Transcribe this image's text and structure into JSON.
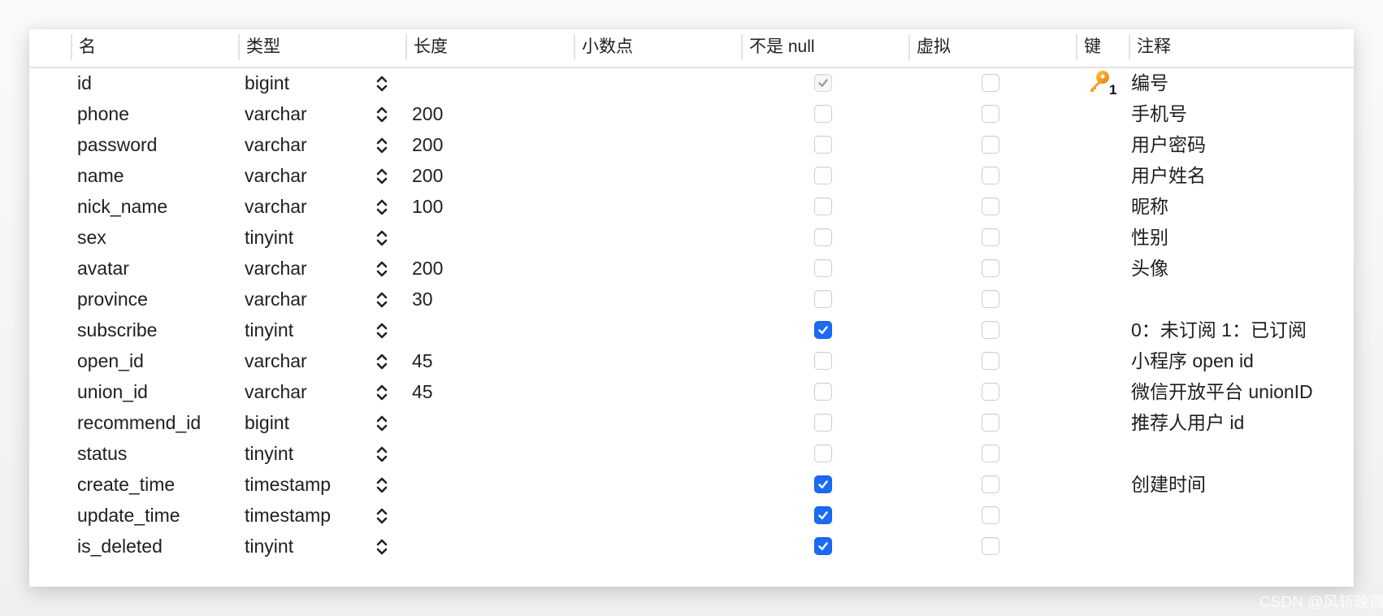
{
  "columns": [
    {
      "key": "name",
      "label": "名"
    },
    {
      "key": "type",
      "label": "类型"
    },
    {
      "key": "length",
      "label": "长度"
    },
    {
      "key": "decimals",
      "label": "小数点"
    },
    {
      "key": "not_null",
      "label": "不是 null"
    },
    {
      "key": "virtual",
      "label": "虚拟"
    },
    {
      "key": "key",
      "label": "键"
    },
    {
      "key": "comment",
      "label": "注释"
    }
  ],
  "rows": [
    {
      "name": "id",
      "type": "bigint",
      "length": "",
      "decimals": "",
      "not_null": true,
      "not_null_disabled": true,
      "virtual": false,
      "key": "primary",
      "key_index": "1",
      "comment": "编号"
    },
    {
      "name": "phone",
      "type": "varchar",
      "length": "200",
      "decimals": "",
      "not_null": false,
      "virtual": false,
      "key": "",
      "comment": "手机号"
    },
    {
      "name": "password",
      "type": "varchar",
      "length": "200",
      "decimals": "",
      "not_null": false,
      "virtual": false,
      "key": "",
      "comment": "用户密码"
    },
    {
      "name": "name",
      "type": "varchar",
      "length": "200",
      "decimals": "",
      "not_null": false,
      "virtual": false,
      "key": "",
      "comment": "用户姓名"
    },
    {
      "name": "nick_name",
      "type": "varchar",
      "length": "100",
      "decimals": "",
      "not_null": false,
      "virtual": false,
      "key": "",
      "comment": "昵称"
    },
    {
      "name": "sex",
      "type": "tinyint",
      "length": "",
      "decimals": "",
      "not_null": false,
      "virtual": false,
      "key": "",
      "comment": "性别"
    },
    {
      "name": "avatar",
      "type": "varchar",
      "length": "200",
      "decimals": "",
      "not_null": false,
      "virtual": false,
      "key": "",
      "comment": "头像"
    },
    {
      "name": "province",
      "type": "varchar",
      "length": "30",
      "decimals": "",
      "not_null": false,
      "virtual": false,
      "key": "",
      "comment": ""
    },
    {
      "name": "subscribe",
      "type": "tinyint",
      "length": "",
      "decimals": "",
      "not_null": true,
      "virtual": false,
      "key": "",
      "comment": "0：未订阅 1：已订阅"
    },
    {
      "name": "open_id",
      "type": "varchar",
      "length": "45",
      "decimals": "",
      "not_null": false,
      "virtual": false,
      "key": "",
      "comment": "小程序 open id"
    },
    {
      "name": "union_id",
      "type": "varchar",
      "length": "45",
      "decimals": "",
      "not_null": false,
      "virtual": false,
      "key": "",
      "comment": "微信开放平台 unionID"
    },
    {
      "name": "recommend_id",
      "type": "bigint",
      "length": "",
      "decimals": "",
      "not_null": false,
      "virtual": false,
      "key": "",
      "comment": "推荐人用户 id"
    },
    {
      "name": "status",
      "type": "tinyint",
      "length": "",
      "decimals": "",
      "not_null": false,
      "virtual": false,
      "key": "",
      "comment": ""
    },
    {
      "name": "create_time",
      "type": "timestamp",
      "length": "",
      "decimals": "",
      "not_null": true,
      "virtual": false,
      "key": "",
      "comment": "创建时间"
    },
    {
      "name": "update_time",
      "type": "timestamp",
      "length": "",
      "decimals": "",
      "not_null": true,
      "virtual": false,
      "key": "",
      "comment": ""
    },
    {
      "name": "is_deleted",
      "type": "tinyint",
      "length": "",
      "decimals": "",
      "not_null": true,
      "virtual": false,
      "key": "",
      "comment": ""
    }
  ],
  "icons": {
    "type_stepper": "chevron-up-down-icon",
    "primary_key": "key-icon",
    "checkbox_checked": "checkmark-icon"
  },
  "colors": {
    "checkbox_accent": "#1a6cf5",
    "key_icon": "#f0a020"
  },
  "watermark": "CSDN @风斩晚霞"
}
